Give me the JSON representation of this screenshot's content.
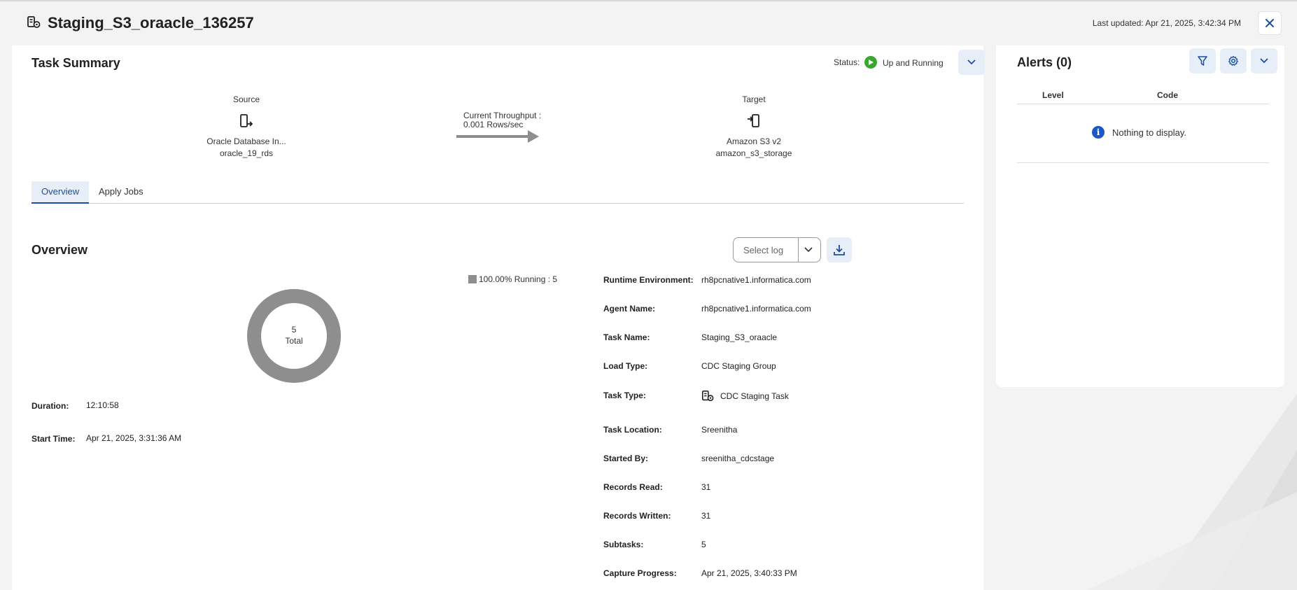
{
  "header": {
    "title": "Staging_S3_oraacle_136257",
    "last_updated": "Last updated: Apr 21, 2025, 3:42:34 PM",
    "icon": "task-icon",
    "close_icon": "close-icon"
  },
  "task_summary": {
    "title": "Task Summary",
    "status_label": "Status:",
    "status_value": "Up and Running",
    "source": {
      "label": "Source",
      "name": "Oracle Database In...",
      "connection": "oracle_19_rds"
    },
    "throughput": {
      "label": "Current Throughput :",
      "value": "0.001 Rows/sec"
    },
    "target": {
      "label": "Target",
      "name": "Amazon S3 v2",
      "connection": "amazon_s3_storage"
    }
  },
  "tabs": [
    {
      "label": "Overview",
      "active": true
    },
    {
      "label": "Apply Jobs",
      "active": false
    }
  ],
  "overview": {
    "title": "Overview",
    "select_log_placeholder": "Select log",
    "legend": "100.00% Running : 5",
    "donut": {
      "total_value": "5",
      "total_label": "Total",
      "running": 5,
      "total": 5,
      "color": "#8e8e8e"
    },
    "duration_label": "Duration:",
    "duration_value": "12:10:58",
    "start_time_label": "Start Time:",
    "start_time_value": "Apr 21, 2025, 3:31:36 AM",
    "details": [
      {
        "label": "Runtime Environment:",
        "value": "rh8pcnative1.informatica.com"
      },
      {
        "label": "Agent Name:",
        "value": "rh8pcnative1.informatica.com"
      },
      {
        "label": "Task Name:",
        "value": "Staging_S3_oraacle"
      },
      {
        "label": "Load Type:",
        "value": "CDC Staging Group"
      },
      {
        "label": "Task Type:",
        "value": "CDC Staging Task"
      },
      {
        "label": "Task Location:",
        "value": "Sreenitha"
      },
      {
        "label": "Started By:",
        "value": "sreenitha_cdcstage"
      },
      {
        "label": "Records Read:",
        "value": "31"
      },
      {
        "label": "Records Written:",
        "value": "31"
      },
      {
        "label": "Subtasks:",
        "value": "5"
      },
      {
        "label": "Capture Progress:",
        "value": "Apr 21, 2025, 3:40:33 PM"
      }
    ]
  },
  "alerts": {
    "title": "Alerts (0)",
    "columns": [
      "Level",
      "Code"
    ],
    "empty_text": "Nothing to display."
  },
  "colors": {
    "accent": "#1a4fa0",
    "status_green": "#3aa62f",
    "info_blue": "#1a56c4"
  }
}
